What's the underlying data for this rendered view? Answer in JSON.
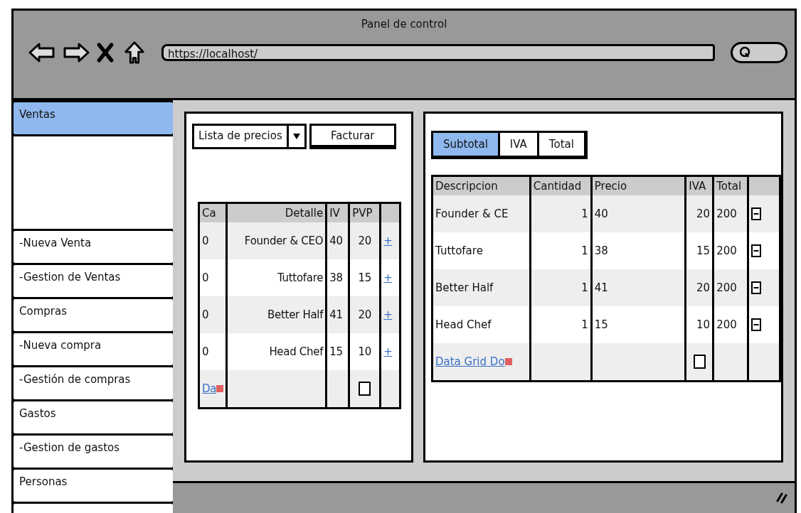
{
  "window": {
    "title": "Panel de control"
  },
  "toolbar": {
    "url": "https://localhost/"
  },
  "sidebar": {
    "items": [
      {
        "label": "Ventas",
        "selected": true
      },
      {
        "label": "-Nueva Venta",
        "selected": false
      },
      {
        "label": "-Gestion de Ventas",
        "selected": false
      },
      {
        "label": "Compras",
        "selected": false
      },
      {
        "label": "-Nueva compra",
        "selected": false
      },
      {
        "label": "-Gestión de compras",
        "selected": false
      },
      {
        "label": "Gastos",
        "selected": false
      },
      {
        "label": "-Gestion de gastos",
        "selected": false
      },
      {
        "label": "Personas",
        "selected": false
      }
    ]
  },
  "left_panel": {
    "dropdown": {
      "value": "Lista de precios"
    },
    "button": "Facturar",
    "table": {
      "columns": [
        "Ca",
        "Detalle",
        "IV",
        "PVP"
      ],
      "rows": [
        {
          "cells": [
            "0",
            "Founder & CEO",
            "40",
            "20"
          ],
          "action": "+"
        },
        {
          "cells": [
            "0",
            "Tuttofare",
            "38",
            "15"
          ],
          "action": "+"
        },
        {
          "cells": [
            "0",
            "Better Half",
            "41",
            "20"
          ],
          "action": "+"
        },
        {
          "cells": [
            "0",
            "Head Chef",
            "15",
            "10"
          ],
          "action": "+"
        }
      ],
      "footer": {
        "link": "Da",
        "checked": false
      }
    }
  },
  "right_panel": {
    "tabs": [
      {
        "label": "Subtotal",
        "selected": true
      },
      {
        "label": "IVA",
        "selected": false
      },
      {
        "label": "Total",
        "selected": false
      }
    ],
    "table": {
      "columns": [
        "Descripcion",
        "Cantidad",
        "Precio",
        "IVA",
        "Total"
      ],
      "rows": [
        {
          "cells": [
            "Founder & CE",
            "1",
            "40",
            "20",
            "200"
          ]
        },
        {
          "cells": [
            "Tuttofare",
            "1",
            "38",
            "15",
            "200"
          ]
        },
        {
          "cells": [
            "Better Half",
            "1",
            "41",
            "20",
            "200"
          ]
        },
        {
          "cells": [
            "Head Chef",
            "1",
            "15",
            "10",
            "200"
          ]
        }
      ],
      "footer": {
        "link": "Data Grid Do",
        "checked": false
      }
    }
  }
}
